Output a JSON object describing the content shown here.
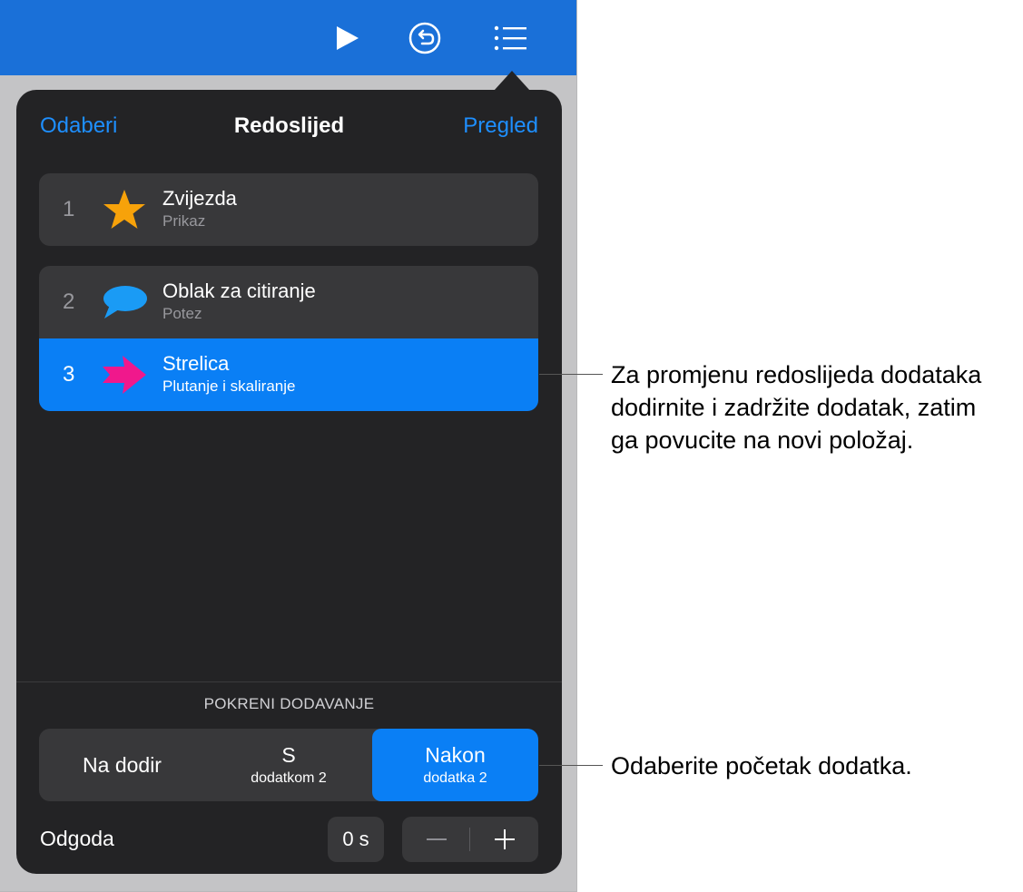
{
  "toolbar": {
    "play_icon": "play-icon",
    "undo_icon": "undo-icon",
    "list_icon": "list-icon"
  },
  "popover": {
    "select_label": "Odaberi",
    "title": "Redoslijed",
    "preview_label": "Pregled",
    "builds": [
      {
        "number": "1",
        "name": "Zvijezda",
        "effect": "Prikaz",
        "icon": "star-icon",
        "icon_color": "#f7a20a"
      },
      {
        "number": "2",
        "name": "Oblak za citiranje",
        "effect": "Potez",
        "icon": "speech-bubble-icon",
        "icon_color": "#1a9bf5"
      },
      {
        "number": "3",
        "name": "Strelica",
        "effect": "Plutanje i skaliranje",
        "icon": "arrow-icon",
        "icon_color": "#f0188c",
        "selected": true
      }
    ],
    "start_build": {
      "label": "POKRENI DODAVANJE",
      "options": [
        {
          "main": "Na dodir",
          "sub": ""
        },
        {
          "main": "S",
          "sub": "dodatkom 2"
        },
        {
          "main": "Nakon",
          "sub": "dodatka 2"
        }
      ],
      "selected_index": 2
    },
    "delay": {
      "label": "Odgoda",
      "value": "0 s",
      "minus": "−",
      "plus": "+"
    }
  },
  "callouts": {
    "reorder": [
      "Za promjenu redoslijeda dodataka",
      "dodirnite i zadržite dodatak, zatim",
      "ga povucite na novi položaj."
    ],
    "start": "Odaberite početak dodatka."
  },
  "colors": {
    "toolbar": "#1a70d8",
    "accent": "#0a7ff5",
    "popover_bg": "#232325",
    "card_bg": "#38383a"
  }
}
